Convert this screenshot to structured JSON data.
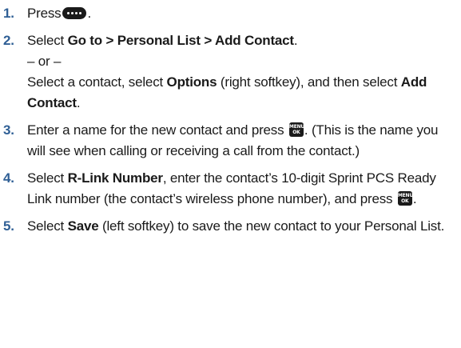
{
  "steps": [
    {
      "number": "1.",
      "before": "Press",
      "icon": "four-dot-navigation-key-icon",
      "after": "."
    },
    {
      "number": "2.",
      "t1": "Select ",
      "b1": "Go to > Personal List > Add Contact",
      "t2": ".",
      "or": "– or –",
      "t3": "Select a contact, select ",
      "b2": "Options",
      "t4": " (right softkey), and then select ",
      "b3": "Add Contact",
      "t5": "."
    },
    {
      "number": "3.",
      "t1": "Enter a name for the new contact and press ",
      "icon": "menu-ok-key-icon",
      "t2": ". (This is the name you will see when calling or receiving a call from the contact.)"
    },
    {
      "number": "4.",
      "t1": "Select ",
      "b1": "R-Link Number",
      "t2": ", enter the contact’s 10-digit Sprint PCS Ready Link number (the contact’s wireless phone number), and press ",
      "icon": "menu-ok-key-icon",
      "t3": "."
    },
    {
      "number": "5.",
      "t1": "Select ",
      "b1": "Save",
      "t2": " (left softkey) to save the new contact to your Personal List."
    }
  ],
  "key_labels": {
    "menu_top": "MENU",
    "menu_bottom": "OK"
  },
  "colors": {
    "step_number": "#2f5f95",
    "text": "#1a1a1a"
  }
}
